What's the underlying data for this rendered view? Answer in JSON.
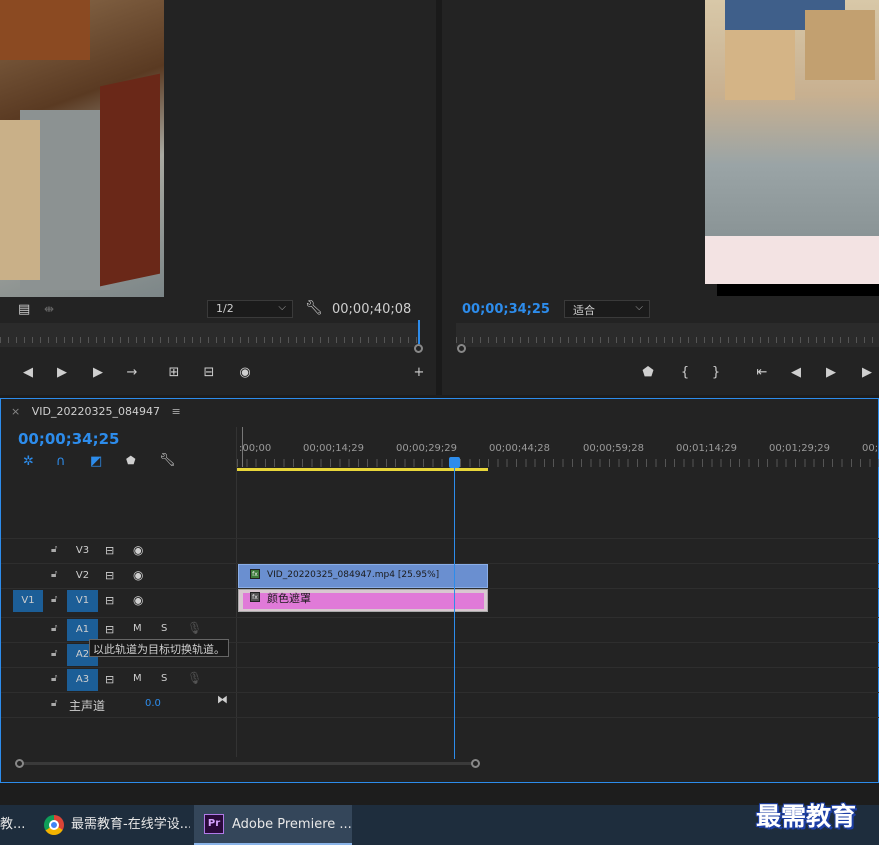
{
  "source_monitor": {
    "zoom_select": "1/2",
    "timecode": "00;00;40;08"
  },
  "program_monitor": {
    "timecode": "00;00;34;25",
    "fit_select": "适合"
  },
  "timeline": {
    "sequence_name": "VID_20220325_084947",
    "timecode": "00;00;34;25",
    "ruler_labels": [
      ":00;00",
      "00;00;14;29",
      "00;00;29;29",
      "00;00;44;28",
      "00;00;59;28",
      "00;01;14;29",
      "00;01;29;29",
      "00;01"
    ],
    "tracks": {
      "v3": "V3",
      "v2": "V2",
      "v1": "V1",
      "v1_source": "V1",
      "a1": "A1",
      "a2": "A2",
      "a3": "A3",
      "mute_label": "M",
      "solo_label": "S",
      "master_label": "主声道",
      "master_value": "0.0"
    },
    "clips": {
      "video_clip": "VID_20220325_084947.mp4 [25.95%]",
      "color_matte": "颜色遮罩"
    },
    "tooltip": "以此轨道为目标切换轨道。"
  },
  "taskbar": {
    "item_partial": "教...",
    "chrome_item": "最需教育-在线学设...",
    "premiere_item": "Adobe Premiere ...",
    "premiere_icon_text": "Pr"
  },
  "watermark": "最需教育"
}
